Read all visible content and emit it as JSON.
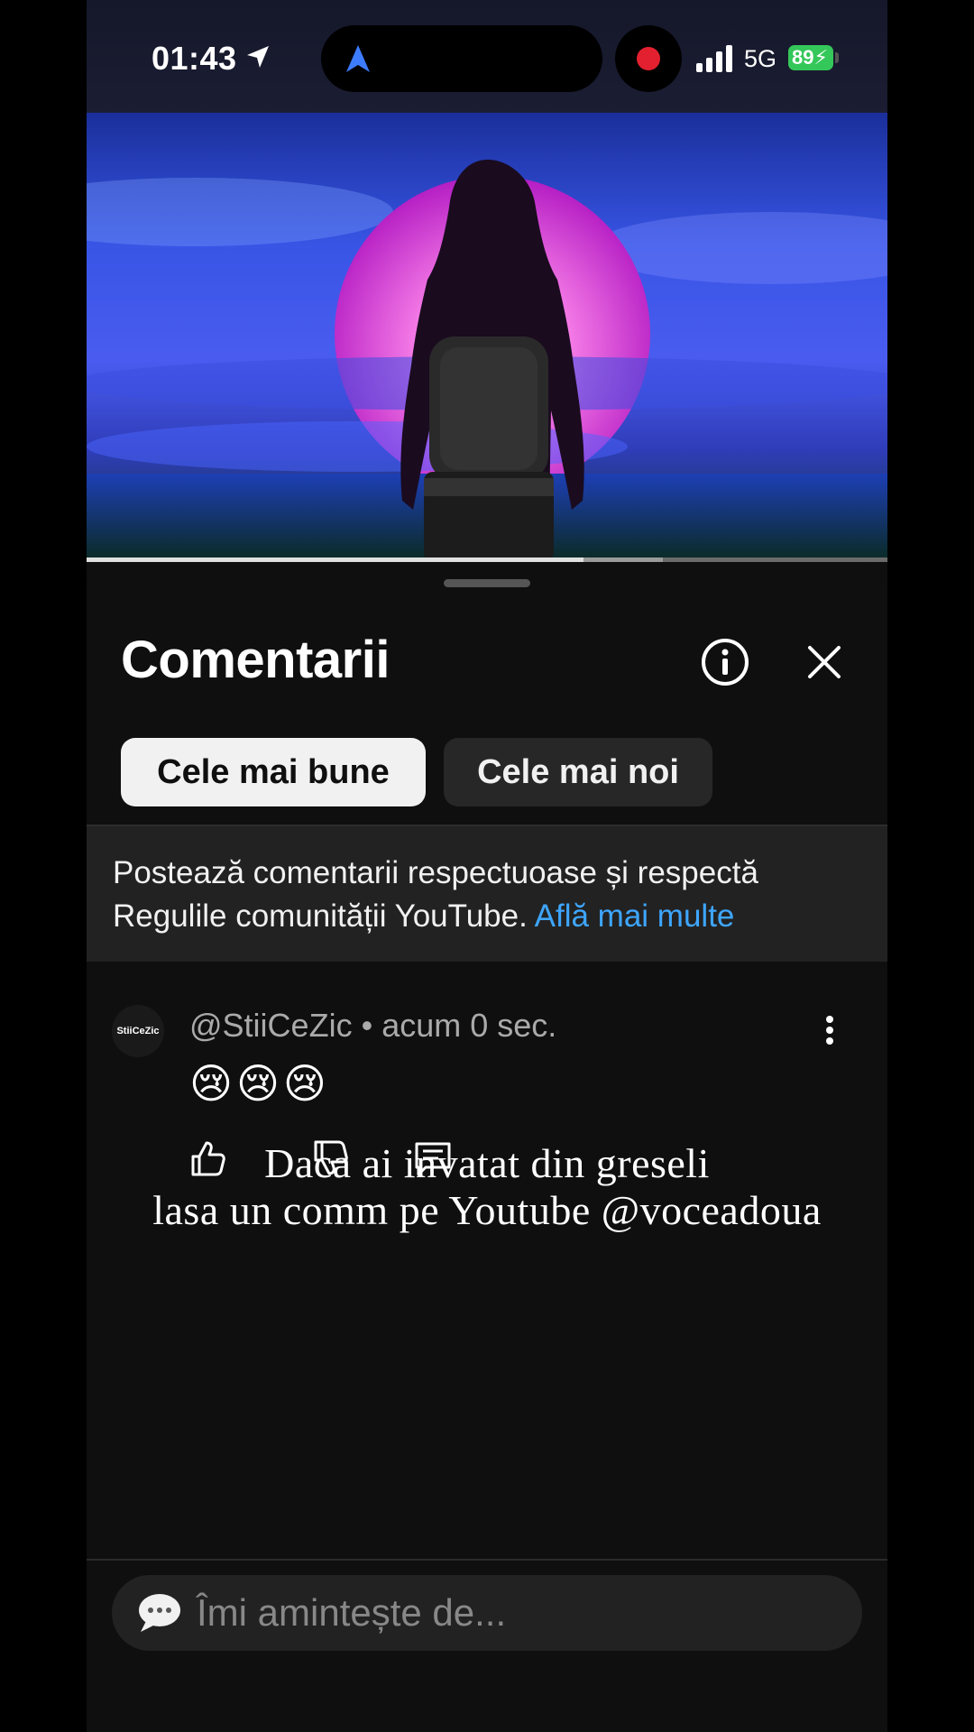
{
  "status_bar": {
    "time": "01:43",
    "network": "5G",
    "battery": "89"
  },
  "video": {
    "progress": 0.62,
    "buffered": 0.72
  },
  "comments_panel": {
    "title": "Comentarii",
    "tabs": [
      {
        "label": "Cele mai bune",
        "selected": true
      },
      {
        "label": "Cele mai noi",
        "selected": false
      }
    ],
    "notice": {
      "text": "Postează comentarii respectuoase și respectă Regulile comunității YouTube.",
      "link": "Află mai multe"
    },
    "comments": [
      {
        "avatar_label": "StiiCeZic",
        "author": "@StiiCeZic",
        "time": "acum 0 sec.",
        "text": "😢😢😢"
      }
    ],
    "input_placeholder": "Îmi amintește de..."
  },
  "overlay_caption": {
    "line1": "Daca ai invatat din greseli",
    "line2": "lasa un comm pe Youtube @voceadoua"
  },
  "colors": {
    "accent_link": "#3ea6ff",
    "record": "#e3202f",
    "battery": "#34c759"
  }
}
